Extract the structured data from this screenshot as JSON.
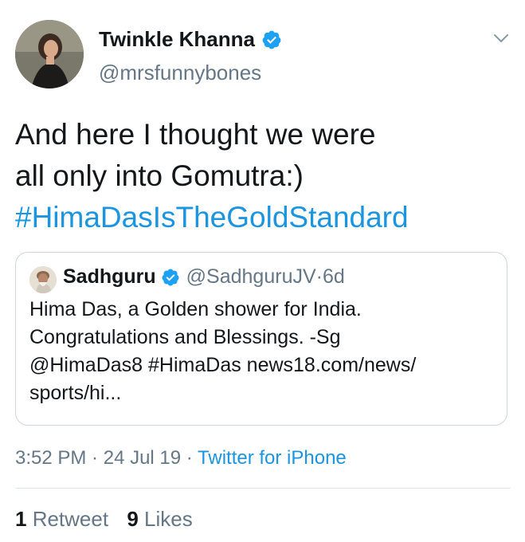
{
  "author": {
    "name": "Twinkle Khanna",
    "handle": "@mrsfunnybones",
    "verified": true
  },
  "tweet": {
    "line1": "And here I thought we were",
    "line2": "all only into Gomutra:)",
    "hashtag": "#HimaDasIsTheGoldStandard"
  },
  "quoted": {
    "name": "Sadhguru",
    "handle": "@SadhguruJV",
    "sep": " · ",
    "age": "6d",
    "line1": "Hima Das, a Golden shower for India.",
    "line2": "Congratulations and Blessings. -Sg",
    "line3": "@HimaDas8 #HimaDas news18.com/news/",
    "line4": "sports/hi..."
  },
  "meta": {
    "time": "3:52 PM",
    "sep1": " · ",
    "date": "24 Jul 19",
    "sep2": " · ",
    "source": "Twitter for iPhone"
  },
  "stats": {
    "retweets": "1",
    "retweets_label": " Retweet",
    "likes": "9",
    "likes_label": " Likes"
  },
  "colors": {
    "link_blue": "#1b95e0",
    "secondary_gray": "#657786",
    "verified_blue": "#1da1f2",
    "border": "#ccd6dd"
  }
}
